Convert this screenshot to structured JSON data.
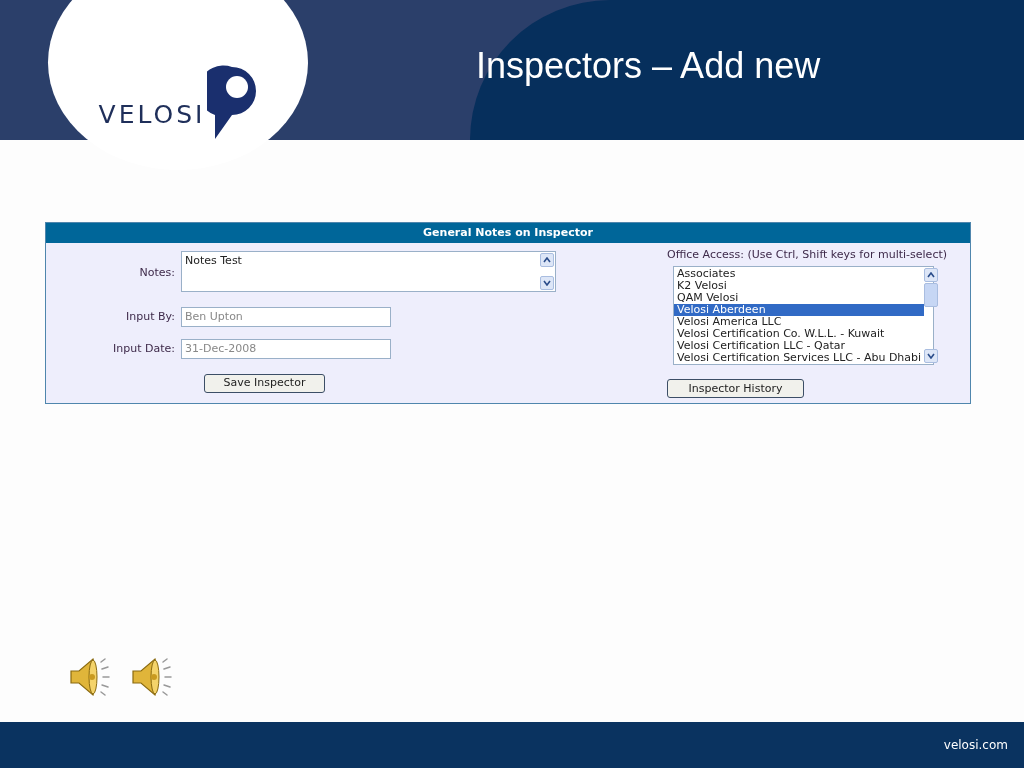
{
  "logo": {
    "text": "VELOSI"
  },
  "title": "Inspectors – Add new",
  "form": {
    "heading": "General Notes on Inspector",
    "notes": {
      "label": "Notes:",
      "value": "Notes Test"
    },
    "input_by": {
      "label": "Input By:",
      "value": "Ben Upton"
    },
    "input_date": {
      "label": "Input Date:",
      "value": "31-Dec-2008"
    },
    "save_button": "Save Inspector",
    "office_access": {
      "label": "Office Access: (Use Ctrl, Shift keys for multi-select)",
      "options": [
        {
          "label": "Associates",
          "selected": false
        },
        {
          "label": "K2 Velosi",
          "selected": false
        },
        {
          "label": "QAM Velosi",
          "selected": false
        },
        {
          "label": "Velosi Aberdeen",
          "selected": true
        },
        {
          "label": "Velosi America LLC",
          "selected": false
        },
        {
          "label": "Velosi Certification Co. W.L.L. - Kuwait",
          "selected": false
        },
        {
          "label": "Velosi Certification LLC - Qatar",
          "selected": false
        },
        {
          "label": "Velosi Certification Services LLC - Abu Dhabi",
          "selected": false
        }
      ]
    },
    "history_button": "Inspector History"
  },
  "footer": {
    "website": "velosi.com"
  }
}
